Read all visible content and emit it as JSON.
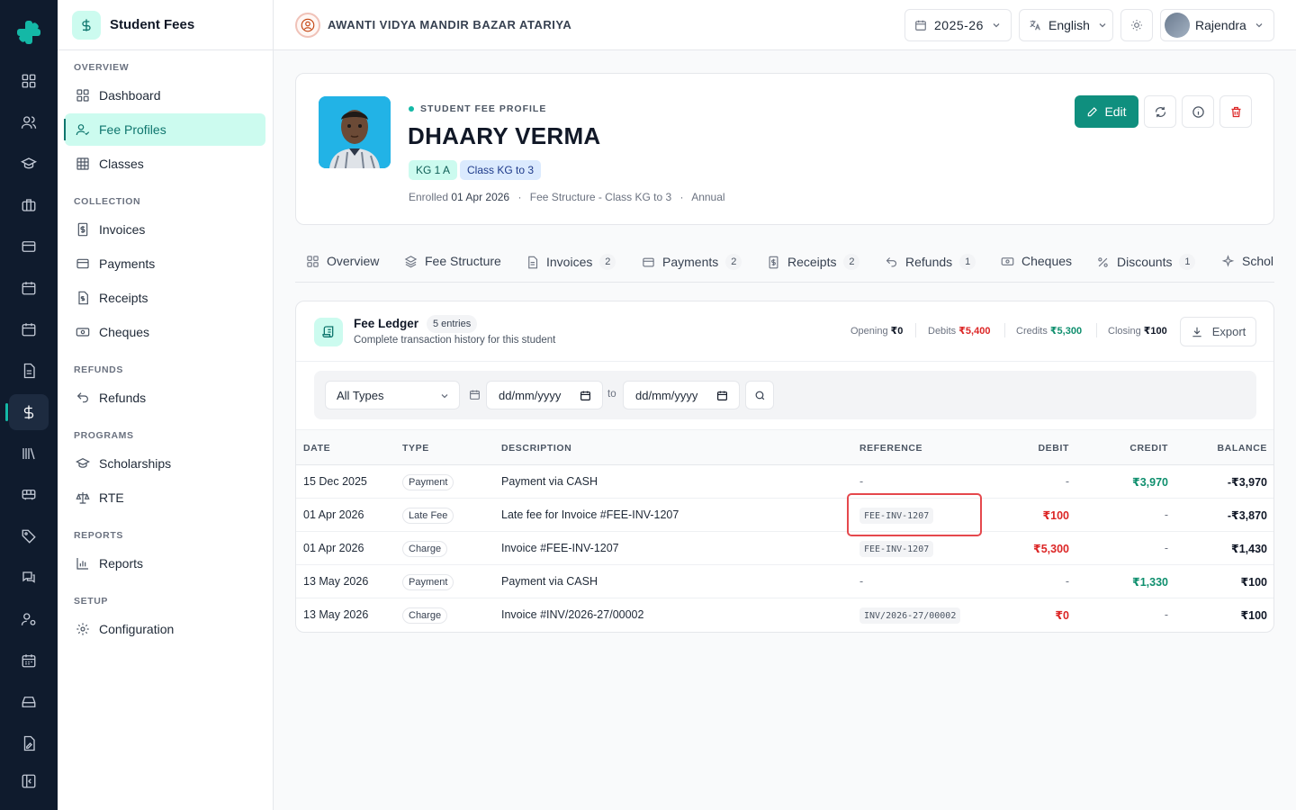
{
  "app": {
    "title": "Student Fees",
    "school_name": "AWANTI VIDYA MANDIR BAZAR ATARIYA"
  },
  "topbar": {
    "year": "2025-26",
    "language": "English",
    "user": "Rajendra"
  },
  "sidebar": {
    "sections": {
      "overview": "OVERVIEW",
      "collection": "COLLECTION",
      "refunds": "REFUNDS",
      "programs": "PROGRAMS",
      "reports": "REPORTS",
      "setup": "SETUP"
    },
    "items": {
      "dashboard": "Dashboard",
      "fee_profiles": "Fee Profiles",
      "classes": "Classes",
      "invoices": "Invoices",
      "payments": "Payments",
      "receipts": "Receipts",
      "cheques": "Cheques",
      "refunds": "Refunds",
      "scholarships": "Scholarships",
      "rte": "RTE",
      "reports": "Reports",
      "configuration": "Configuration"
    }
  },
  "profile": {
    "eyebrow": "STUDENT FEE PROFILE",
    "name": "DHAARY VERMA",
    "chips": [
      "KG 1 A",
      "Class KG to 3"
    ],
    "enrolled_label": "Enrolled",
    "enrolled_date": "01 Apr 2026",
    "fee_structure": "Fee Structure - Class KG to 3",
    "frequency": "Annual",
    "separator": "·",
    "edit_label": "Edit"
  },
  "tabs": [
    {
      "label": "Overview",
      "count": ""
    },
    {
      "label": "Fee Structure",
      "count": ""
    },
    {
      "label": "Invoices",
      "count": "2"
    },
    {
      "label": "Payments",
      "count": "2"
    },
    {
      "label": "Receipts",
      "count": "2"
    },
    {
      "label": "Refunds",
      "count": "1"
    },
    {
      "label": "Cheques",
      "count": ""
    },
    {
      "label": "Discounts",
      "count": "1"
    },
    {
      "label": "Schol",
      "count": ""
    }
  ],
  "ledger": {
    "title": "Fee Ledger",
    "entries": "5 entries",
    "subtitle": "Complete transaction history for this student",
    "summary": {
      "opening_label": "Opening",
      "opening": "₹0",
      "debits_label": "Debits",
      "debits": "₹5,400",
      "credits_label": "Credits",
      "credits": "₹5,300",
      "closing_label": "Closing",
      "closing": "₹100"
    },
    "export_label": "Export",
    "filter": {
      "type": "All Types",
      "from": "dd/mm/yyyy",
      "to_label": "to",
      "to": "dd/mm/yyyy"
    },
    "columns": [
      "DATE",
      "TYPE",
      "DESCRIPTION",
      "REFERENCE",
      "DEBIT",
      "CREDIT",
      "BALANCE"
    ],
    "rows": [
      {
        "date": "15 Dec 2025",
        "type": "Payment",
        "description": "Payment via CASH",
        "reference": "-",
        "debit": "-",
        "credit": "₹3,970",
        "balance": "-₹3,970"
      },
      {
        "date": "01 Apr 2026",
        "type": "Late Fee",
        "description": "Late fee for Invoice #FEE-INV-1207",
        "reference": "FEE-INV-1207",
        "debit": "₹100",
        "credit": "-",
        "balance": "-₹3,870"
      },
      {
        "date": "01 Apr 2026",
        "type": "Charge",
        "description": "Invoice #FEE-INV-1207",
        "reference": "FEE-INV-1207",
        "debit": "₹5,300",
        "credit": "-",
        "balance": "₹1,430"
      },
      {
        "date": "13 May 2026",
        "type": "Payment",
        "description": "Payment via CASH",
        "reference": "-",
        "debit": "-",
        "credit": "₹1,330",
        "balance": "₹100"
      },
      {
        "date": "13 May 2026",
        "type": "Charge",
        "description": "Invoice #INV/2026-27/00002",
        "reference": "INV/2026-27/00002",
        "debit": "₹0",
        "credit": "-",
        "balance": "₹100"
      }
    ]
  },
  "colors": {
    "accent": "#0f8f7e",
    "rail_bg": "#0f1b2d",
    "debit": "#dc2626",
    "credit": "#0f8f6e",
    "highlight": "#e5484d"
  }
}
